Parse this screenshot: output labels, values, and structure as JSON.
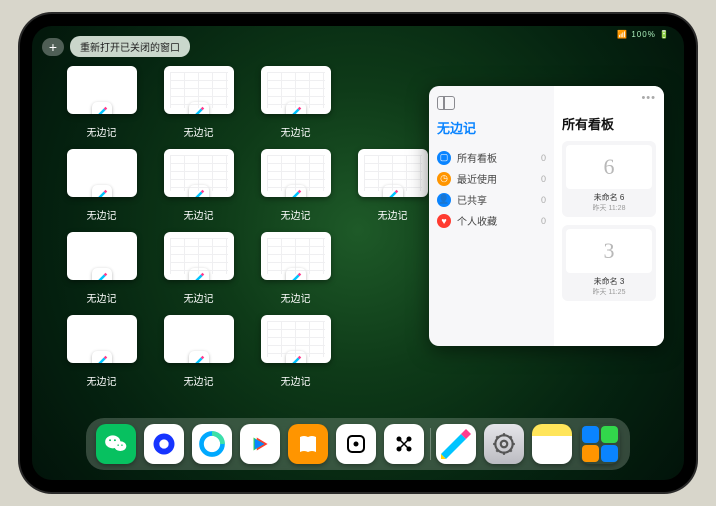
{
  "status": {
    "text": "📶 100% 🔋"
  },
  "topbar": {
    "add": "+",
    "reopen": "重新打开已关闭的窗口"
  },
  "thumbs": [
    {
      "label": "无边记",
      "variant": "blank"
    },
    {
      "label": "无边记",
      "variant": "cal"
    },
    {
      "label": "无边记",
      "variant": "cal"
    },
    {
      "label": "",
      "variant": "hidden"
    },
    {
      "label": "无边记",
      "variant": "blank"
    },
    {
      "label": "无边记",
      "variant": "cal"
    },
    {
      "label": "无边记",
      "variant": "cal"
    },
    {
      "label": "无边记",
      "variant": "cal"
    },
    {
      "label": "无边记",
      "variant": "blank"
    },
    {
      "label": "无边记",
      "variant": "cal"
    },
    {
      "label": "无边记",
      "variant": "cal"
    },
    {
      "label": "",
      "variant": "hidden"
    },
    {
      "label": "无边记",
      "variant": "blank"
    },
    {
      "label": "无边记",
      "variant": "blank"
    },
    {
      "label": "无边记",
      "variant": "cal"
    },
    {
      "label": "",
      "variant": "hidden"
    }
  ],
  "panel": {
    "title": "无边记",
    "right_title": "所有看板",
    "more": "•••",
    "nav": [
      {
        "icon": "square",
        "color": "#0a84ff",
        "label": "所有看板",
        "count": "0"
      },
      {
        "icon": "clock",
        "color": "#ff9500",
        "label": "最近使用",
        "count": "0"
      },
      {
        "icon": "person",
        "color": "#0a84ff",
        "label": "已共享",
        "count": "0"
      },
      {
        "icon": "heart",
        "color": "#ff3b30",
        "label": "个人收藏",
        "count": "0"
      }
    ],
    "cards": [
      {
        "glyph": "6",
        "name": "未命名 6",
        "sub": "昨天 11:28"
      },
      {
        "glyph": "3",
        "name": "未命名 3",
        "sub": "昨天 11:25"
      }
    ]
  },
  "dock": [
    {
      "name": "wechat",
      "bg": "#07c160",
      "glyph": "wechat"
    },
    {
      "name": "quark",
      "bg": "#ffffff",
      "glyph": "quark"
    },
    {
      "name": "qqbrowser",
      "bg": "#ffffff",
      "glyph": "qqbrowser"
    },
    {
      "name": "youku",
      "bg": "#ffffff",
      "glyph": "youku"
    },
    {
      "name": "books",
      "bg": "#ff9500",
      "glyph": "books"
    },
    {
      "name": "dice",
      "bg": "#ffffff",
      "glyph": "dice"
    },
    {
      "name": "grid-app",
      "bg": "#ffffff",
      "glyph": "gridapp"
    },
    {
      "name": "freeform",
      "bg": "#ffffff",
      "glyph": "freeform",
      "sep": true
    },
    {
      "name": "settings",
      "bg": "linear-gradient(#e5e5ea,#bcbcc2)",
      "glyph": "gear"
    },
    {
      "name": "notes",
      "bg": "linear-gradient(#ffe55a 0 30%,#fff 30%)",
      "glyph": ""
    },
    {
      "name": "folder",
      "bg": "transparent",
      "glyph": "folder"
    }
  ]
}
